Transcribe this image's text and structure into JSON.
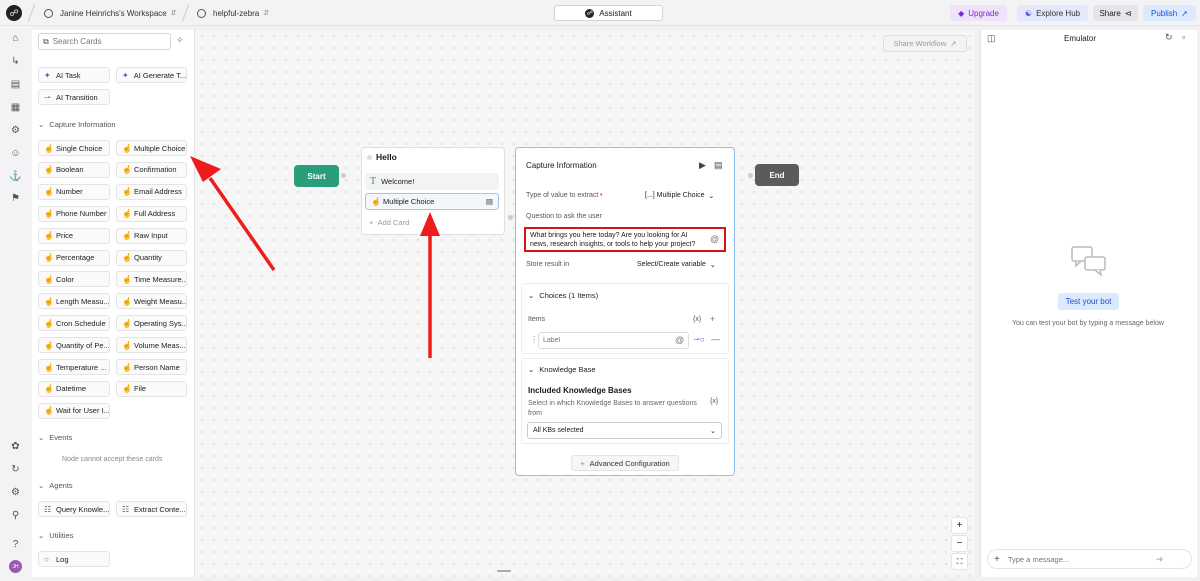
{
  "topbar": {
    "workspace": "Janine Heinrichs's Workspace",
    "project": "helpful-zebra",
    "assistant_label": "Assistant",
    "upgrade_label": "Upgrade",
    "explore_label": "Explore Hub",
    "share_label": "Share",
    "publish_label": "Publish"
  },
  "library": {
    "search_placeholder": "Search Cards",
    "ai_cards": [
      "AI Task",
      "AI Generate T...",
      "AI Transition"
    ],
    "capture_heading": "Capture Information",
    "capture_cards": [
      "Single Choice",
      "Multiple Choice",
      "Boolean",
      "Confirmation",
      "Number",
      "Email Address",
      "Phone Number",
      "Full Address",
      "Price",
      "Raw Input",
      "Percentage",
      "Quantity",
      "Color",
      "Time Measure...",
      "Length Measu...",
      "Weight Measu...",
      "Cron Schedule",
      "Operating Sys...",
      "Quantity of Pe...",
      "Volume Meas...",
      "Temperature ...",
      "Person Name",
      "Datetime",
      "File",
      "Wait for User I..."
    ],
    "events_heading": "Events",
    "events_empty": "Node cannot accept these cards",
    "agents_heading": "Agents",
    "agent_cards": [
      "Query Knowle...",
      "Extract Conte..."
    ],
    "utilities_heading": "Utilities",
    "utility_cards": [
      "Log"
    ]
  },
  "canvas": {
    "share_workflow": "Share Workflow",
    "start_label": "Start",
    "end_label": "End",
    "node_title": "Hello",
    "node_items": [
      "Welcome!",
      "Multiple Choice"
    ],
    "add_card": "Add Card",
    "zoom_in": "+",
    "zoom_out": "−"
  },
  "panel": {
    "title": "Capture Information",
    "type_label": "Type of value to extract",
    "type_value": "[...]  Multiple Choice",
    "question_label": "Question to ask the user",
    "question_text": "What brings you here today? Are you looking for AI news, research insights, or tools to help your project?",
    "store_label": "Store result in",
    "store_value": "Select/Create variable",
    "choices_heading": "Choices (1 Items)",
    "items_label": "Items",
    "var_glyph": "{x}",
    "label_placeholder": "Label",
    "kb_heading": "Knowledge Base",
    "kb_title": "Included Knowledge Bases",
    "kb_desc": "Select in which Knowledge Bases to answer questions from",
    "kb_select": "All KBs selected",
    "advanced": "Advanced Configuration"
  },
  "emulator": {
    "title": "Emulator",
    "test_button": "Test your bot",
    "hint": "You can test your bot by typing a message below",
    "input_placeholder": "Type a message..."
  },
  "user": {
    "initials": "JH"
  },
  "colors": {
    "accent": "#2563eb",
    "start": "#2a9d7a",
    "end": "#5b5b5b",
    "annotation": "#ee1c1c",
    "highlight_box": "#dd1111"
  }
}
